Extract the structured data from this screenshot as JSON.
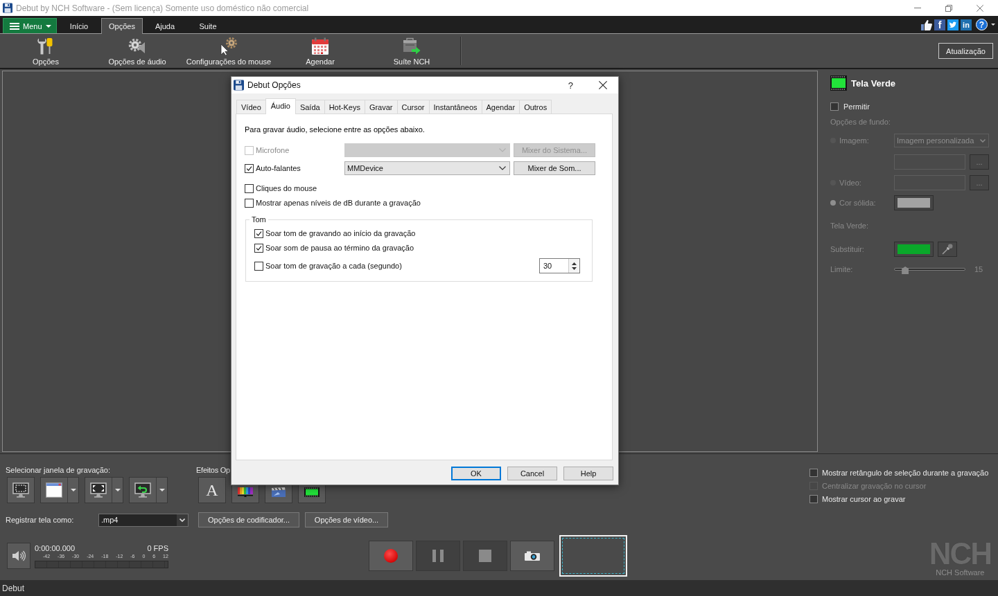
{
  "window": {
    "title": "Debut by NCH Software - (Sem licença) Somente uso doméstico não comercial"
  },
  "menu_bar": {
    "menu_button": "Menu",
    "tabs": [
      {
        "label": "Início",
        "selected": false
      },
      {
        "label": "Opções",
        "selected": true
      },
      {
        "label": "Ajuda",
        "selected": false
      },
      {
        "label": "Suite",
        "selected": false
      }
    ],
    "social_icons": [
      {
        "kind": "like"
      },
      {
        "kind": "facebook",
        "glyph": "f"
      },
      {
        "kind": "twitter"
      },
      {
        "kind": "linkedin",
        "glyph": "in"
      },
      {
        "kind": "help",
        "glyph": "?"
      }
    ]
  },
  "toolbar": {
    "items": [
      {
        "kind": "tools",
        "label": "Opções"
      },
      {
        "kind": "audio",
        "label": "Opções de áudio"
      },
      {
        "kind": "mouse",
        "label": "Configurações do mouse"
      },
      {
        "kind": "calendar",
        "label": "Agendar"
      },
      {
        "kind": "suite",
        "label": "Suíte NCH"
      }
    ],
    "update_button": "Atualização"
  },
  "green_screen": {
    "title": "Tela Verde",
    "enable": {
      "label": "Permitir",
      "checked": false
    },
    "background_label": "Opções de fundo:",
    "backgrounds": [
      {
        "kind": "image",
        "label": "Imagem:",
        "selected": false,
        "choice": "Imagem personalizada",
        "browse": "..."
      },
      {
        "kind": "video",
        "label": "Vídeo:",
        "selected": false,
        "browse": "..."
      },
      {
        "kind": "color",
        "label": "Cor sólida:",
        "selected": true,
        "color": "#a3a3a3"
      }
    ],
    "key_label": "Tela Verde:",
    "replace": {
      "label": "Substituir:",
      "color": "#0aa82a"
    },
    "threshold": {
      "label": "Limite:",
      "level": 0.15,
      "value": "15"
    }
  },
  "capture": {
    "window_label": "Selecionar janela de gravação:",
    "window_buttons": [
      {
        "kind": "region",
        "dropdown": false
      },
      {
        "kind": "window",
        "dropdown": true
      },
      {
        "kind": "fullscreen",
        "dropdown": true
      },
      {
        "kind": "previous",
        "dropdown": true
      }
    ],
    "effects_label": "Efeitos Op",
    "effect_buttons": [
      {
        "kind": "text",
        "glyph": "A"
      },
      {
        "kind": "color"
      },
      {
        "kind": "overlay"
      },
      {
        "kind": "green"
      }
    ],
    "format_label": "Registrar tela como:",
    "format": ".mp4",
    "encoder_button": "Opções de codificador...",
    "video_button": "Opções de vídeo...",
    "time": "0:00:00.000",
    "fps": "0 FPS",
    "meter_scale": [
      "-42",
      "-36",
      "-30",
      "-24",
      "-18",
      "-12",
      "-6",
      "0",
      "6",
      "12"
    ],
    "transport": [
      {
        "kind": "record",
        "disabled": false
      },
      {
        "kind": "pause",
        "disabled": true
      },
      {
        "kind": "stop",
        "disabled": true
      },
      {
        "kind": "snapshot",
        "disabled": false
      }
    ],
    "options": [
      {
        "label": "Mostrar retângulo de seleção durante a gravação",
        "checked": false,
        "disabled": false
      },
      {
        "label": "Centralizar gravação no cursor",
        "checked": false,
        "disabled": true
      },
      {
        "label": "Mostrar cursor ao gravar",
        "checked": false,
        "disabled": false
      }
    ],
    "logo": {
      "mark": "NCH",
      "caption": "NCH Software"
    }
  },
  "dialog": {
    "title": "Debut Opções",
    "help": "?",
    "tabs": [
      {
        "label": "Vídeo",
        "selected": false
      },
      {
        "label": "Áudio",
        "selected": true
      },
      {
        "label": "Saída",
        "selected": false
      },
      {
        "label": "Hot-Keys",
        "selected": false
      },
      {
        "label": "Gravar",
        "selected": false
      },
      {
        "label": "Cursor",
        "selected": false
      },
      {
        "label": "Instantâneos",
        "selected": false
      },
      {
        "label": "Agendar",
        "selected": false
      },
      {
        "label": "Outros",
        "selected": false
      }
    ],
    "intro": "Para gravar áudio, selecione entre as opções abaixo.",
    "sources": [
      {
        "label": "Microfone",
        "checked": false,
        "disabled": true,
        "button": "Mixer do Sistema..."
      },
      {
        "label": "Auto-falantes",
        "checked": true,
        "disabled": false,
        "device": "MMDevice",
        "button": "Mixer de Som..."
      }
    ],
    "options": [
      {
        "label": "Cliques do mouse",
        "checked": false
      },
      {
        "label": "Mostrar apenas níveis de dB durante a gravação",
        "checked": false
      }
    ],
    "tone_group": {
      "title": "Tom",
      "options": [
        {
          "label": "Soar tom de gravando ao início da gravação",
          "checked": true
        },
        {
          "label": "Soar som de pausa ao término da gravação",
          "checked": true
        },
        {
          "label": "Soar tom de gravação a cada (segundo)",
          "checked": false,
          "interval": "30"
        }
      ]
    },
    "buttons": [
      {
        "label": "OK",
        "default": true
      },
      {
        "label": "Cancel",
        "default": false
      },
      {
        "label": "Help",
        "default": false
      }
    ]
  },
  "status_bar": {
    "text": "Debut"
  }
}
